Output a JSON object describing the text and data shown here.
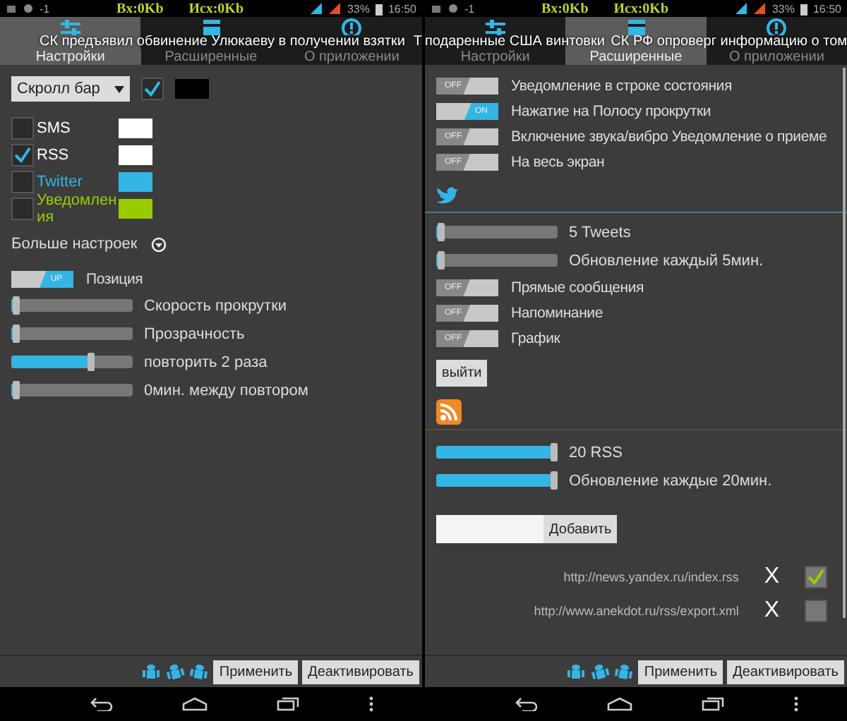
{
  "screens": [
    {
      "status_bar": {
        "notification_count": "-1",
        "rx": "Вх:0Kb",
        "tx": "Исх:0Kb",
        "battery": "33%",
        "time": "16:50"
      },
      "tabs": [
        {
          "label": "Настройки",
          "selected": true
        },
        {
          "label": "Расширенные",
          "selected": false
        },
        {
          "label": "О приложении",
          "selected": false
        }
      ],
      "ticker": [
        "СК предъявил обвинение Улюкаеву в получении взятки",
        "Т"
      ],
      "items": [
        {
          "kind": "dropdown",
          "value": "Скролл бар",
          "checked": true,
          "color": "#000000"
        },
        {
          "kind": "source",
          "label": "SMS",
          "checked": false,
          "color": "#ffffff"
        },
        {
          "kind": "source",
          "label": "RSS",
          "checked": true,
          "color": "#ffffff"
        },
        {
          "kind": "source",
          "label": "Twitter",
          "checked": false,
          "color": "#33b5e5"
        },
        {
          "kind": "source",
          "label": "Уведомления",
          "checked": false,
          "color": "#99cc00"
        },
        {
          "kind": "more",
          "label": "Больше настроек"
        },
        {
          "kind": "toggle",
          "label": "Позиция",
          "on": true,
          "state_text": "UP"
        },
        {
          "kind": "slider",
          "label": "Скорость прокрутки",
          "level": 0.02
        },
        {
          "kind": "slider",
          "label": "Прозрачность",
          "level": 0.02
        },
        {
          "kind": "slider",
          "label": "повторить 2 раза",
          "level": 0.65
        },
        {
          "kind": "slider",
          "label": "0мин. между повтором",
          "level": 0.02
        }
      ],
      "bottom_buttons": [
        "Применить",
        "Деактивировать"
      ]
    },
    {
      "status_bar": {
        "notification_count": "-1",
        "rx": "Вх:0Kb",
        "tx": "Исх:0Kb",
        "battery": "33%",
        "time": "16:50"
      },
      "tabs": [
        {
          "label": "Настройки",
          "selected": false
        },
        {
          "label": "Расширенные",
          "selected": true
        },
        {
          "label": "О приложении",
          "selected": false
        }
      ],
      "ticker": [
        "подаренные США винтовки",
        "СК РФ опроверг информацию о том"
      ],
      "items": [
        {
          "kind": "toggle",
          "label": "Уведомление в строке состояния",
          "on": false,
          "state_text": "OFF"
        },
        {
          "kind": "toggle",
          "label": "Нажатие на Полосу прокрутки",
          "on": true,
          "state_text": "ON"
        },
        {
          "kind": "toggle",
          "label": "Включение звука/вибро Уведомление о приеме",
          "on": false,
          "state_text": "OFF"
        },
        {
          "kind": "toggle",
          "label": "На весь экран",
          "on": false,
          "state_text": "OFF"
        },
        {
          "kind": "twitter_header"
        },
        {
          "kind": "slider",
          "label": "5 Tweets",
          "level": 0.02
        },
        {
          "kind": "slider",
          "label": "Обновление каждый 5мин.",
          "level": 0.02
        },
        {
          "kind": "toggle",
          "label": "Прямые сообщения",
          "on": false,
          "state_text": "OFF"
        },
        {
          "kind": "toggle",
          "label": "Напоминание",
          "on": false,
          "state_text": "OFF"
        },
        {
          "kind": "toggle",
          "label": "График",
          "on": false,
          "state_text": "OFF"
        },
        {
          "kind": "button",
          "label": "выйти"
        },
        {
          "kind": "rss_header"
        },
        {
          "kind": "slider",
          "label": "20 RSS",
          "level": 1
        },
        {
          "kind": "slider",
          "label": "Обновление каждые 20мин.",
          "level": 1
        },
        {
          "kind": "add_feed",
          "button": "Добавить"
        },
        {
          "kind": "feed",
          "url": "http://news.yandex.ru/index.rss",
          "remove": "X",
          "checked": true
        },
        {
          "kind": "feed",
          "url": "http://www.anekdot.ru/rss/export.xml",
          "remove": "X",
          "checked": false
        }
      ],
      "bottom_buttons": [
        "Применить",
        "Деактивировать"
      ]
    }
  ]
}
